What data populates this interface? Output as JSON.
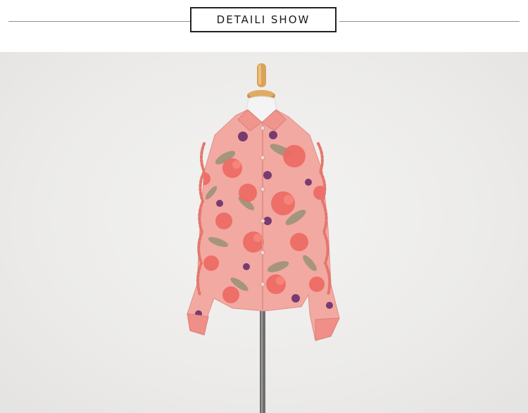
{
  "header": {
    "title": "DETAILI SHOW"
  },
  "colors": {
    "blouse_base": "#f2a9a2",
    "flower_coral": "#ee6a63",
    "flower_purple": "#6b2f6c",
    "leaf": "#8a8f6f",
    "stand_wood": "#d9a25a"
  }
}
